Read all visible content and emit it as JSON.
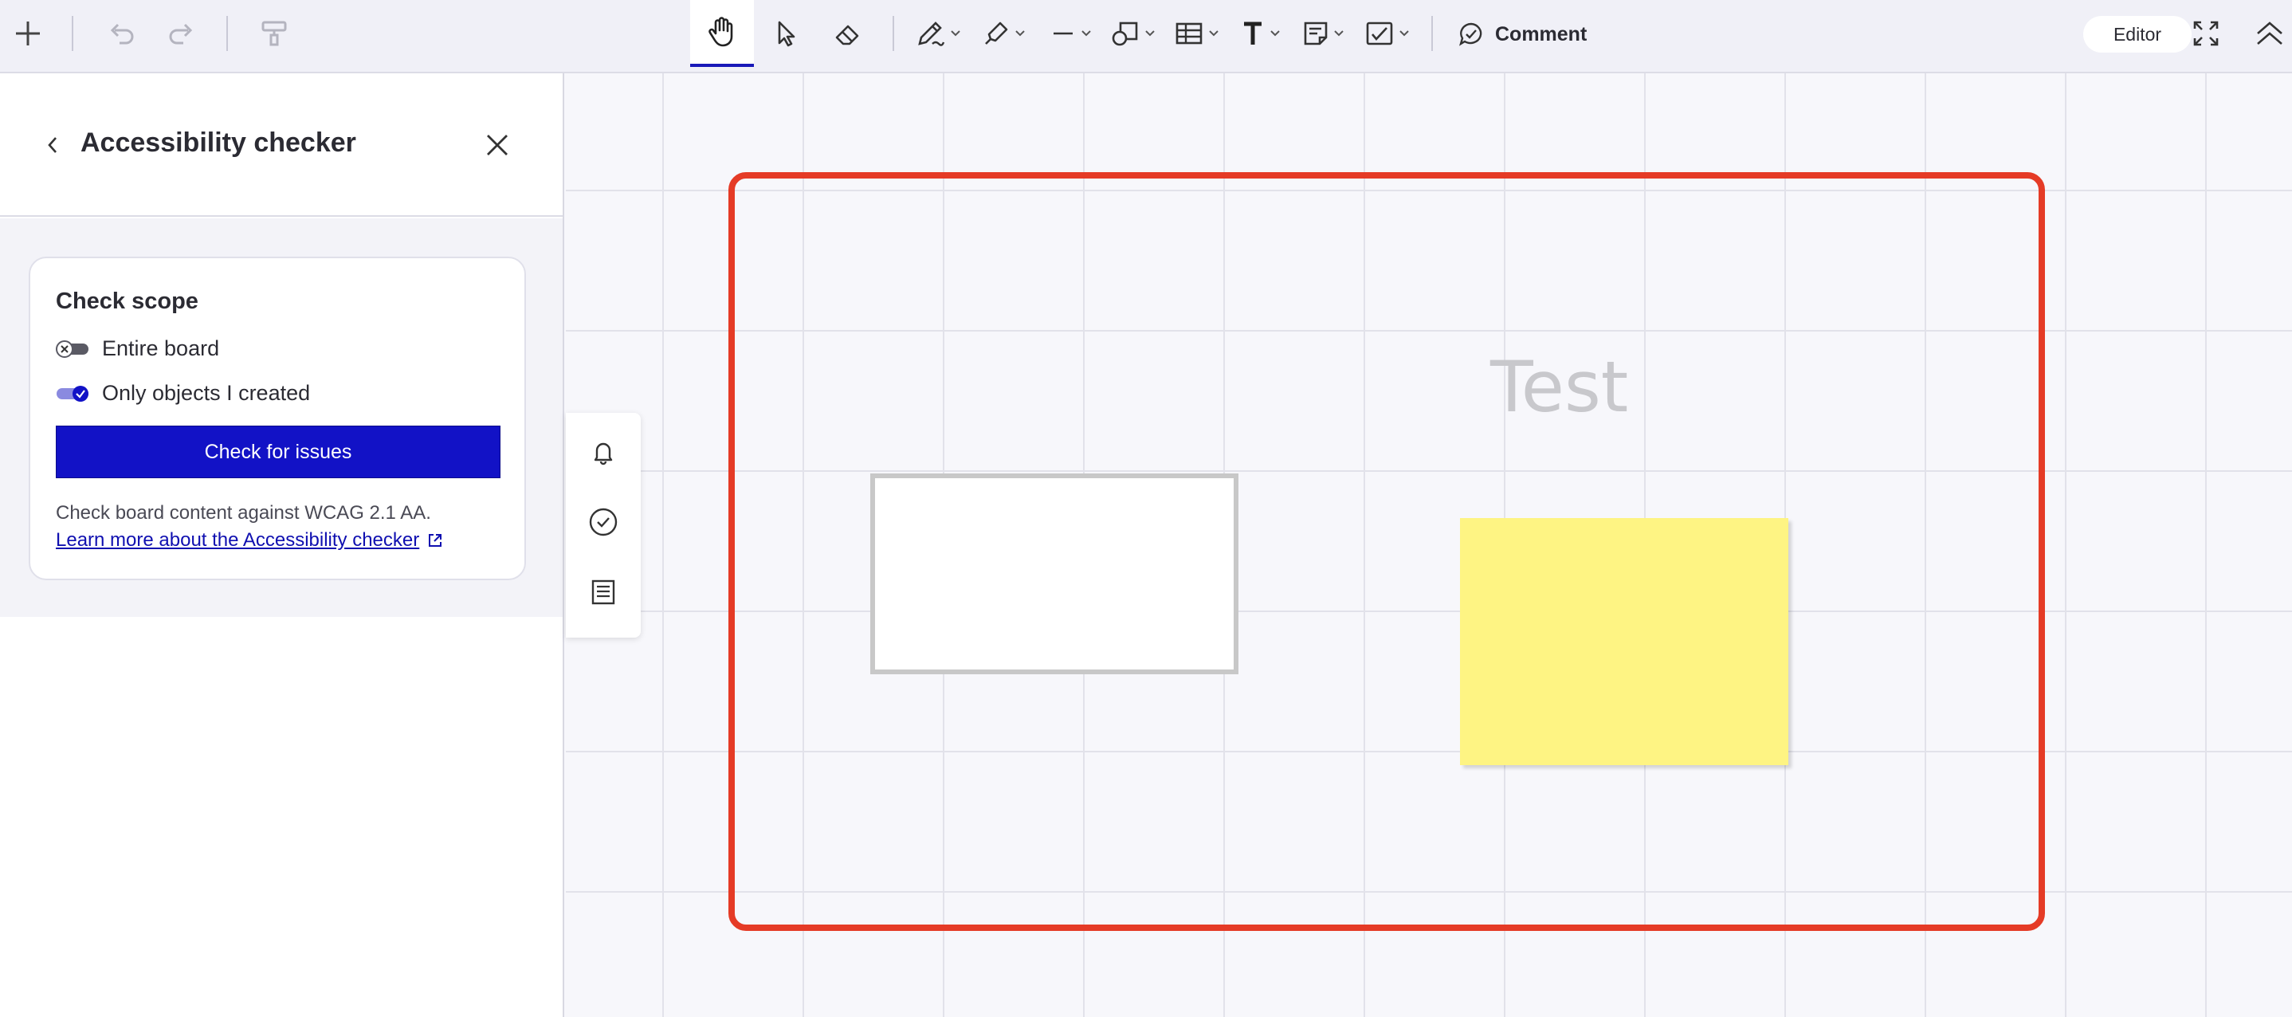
{
  "toolbar": {
    "tools": [
      {
        "name": "add",
        "icon": "plus-icon"
      },
      {
        "name": "undo",
        "icon": "undo-icon"
      },
      {
        "name": "redo",
        "icon": "redo-icon"
      },
      {
        "name": "format-painter",
        "icon": "paint-roller-icon"
      },
      {
        "name": "hand",
        "icon": "hand-icon",
        "active": true
      },
      {
        "name": "select",
        "icon": "cursor-icon"
      },
      {
        "name": "eraser",
        "icon": "eraser-icon"
      },
      {
        "name": "pen",
        "icon": "pen-icon"
      },
      {
        "name": "highlighter",
        "icon": "highlighter-icon"
      },
      {
        "name": "line",
        "icon": "line-icon"
      },
      {
        "name": "shapes",
        "icon": "shapes-icon"
      },
      {
        "name": "table",
        "icon": "table-icon"
      },
      {
        "name": "text",
        "icon": "text-icon"
      },
      {
        "name": "sticky-note",
        "icon": "sticky-note-icon"
      },
      {
        "name": "checkbox",
        "icon": "checkbox-icon"
      }
    ],
    "comment_label": "Comment",
    "mode_label": "Editor",
    "accent_color": "#1919b8"
  },
  "panel": {
    "title": "Accessibility checker",
    "card": {
      "title": "Check scope",
      "options": [
        {
          "label": "Entire board",
          "enabled": false
        },
        {
          "label": "Only objects I created",
          "enabled": true
        }
      ],
      "button_label": "Check for issues",
      "description": "Check board content against WCAG 2.1 AA.",
      "link_text": "Learn more about the Accessibility checker"
    }
  },
  "mini_toolbar": [
    {
      "icon": "bell-icon"
    },
    {
      "icon": "check-circle-icon"
    },
    {
      "icon": "list-icon"
    }
  ],
  "canvas": {
    "text": "Test",
    "frame_color": "#e53b26",
    "sticky_color": "#fef483"
  }
}
